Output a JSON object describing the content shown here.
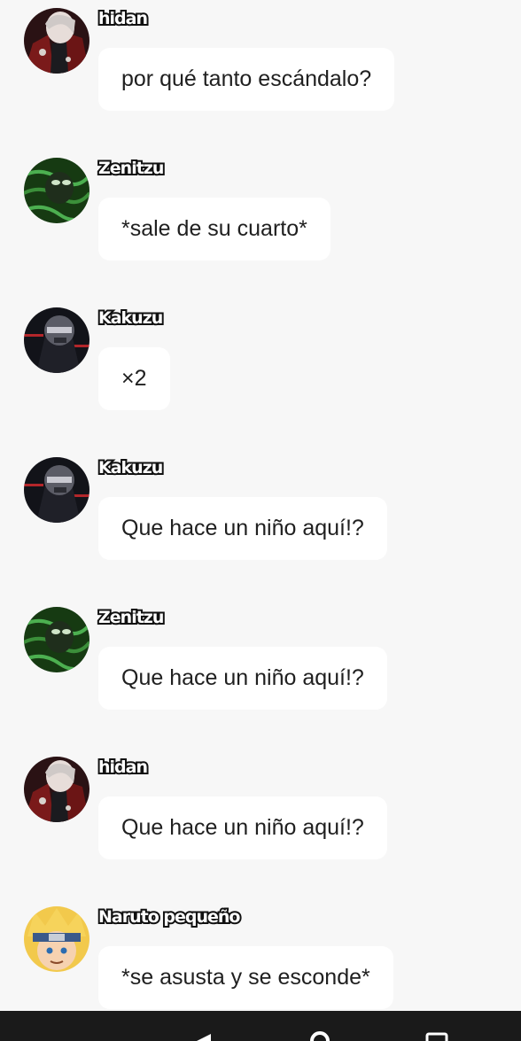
{
  "messages": [
    {
      "author": "hidan",
      "text": "por qué tanto escándalo?",
      "avatar": "hidan-avatar-icon"
    },
    {
      "author": "Zenitzu",
      "text": "*sale de su cuarto*",
      "avatar": "zenitzu-avatar-icon"
    },
    {
      "author": "Kakuzu",
      "text": "×2",
      "avatar": "kakuzu-avatar-icon"
    },
    {
      "author": "Kakuzu",
      "text": "Que hace un niño aquí!?",
      "avatar": "kakuzu-avatar-icon"
    },
    {
      "author": "Zenitzu",
      "text": "Que hace un niño aquí!?",
      "avatar": "zenitzu-avatar-icon"
    },
    {
      "author": "hidan",
      "text": "Que hace un niño aquí!?",
      "avatar": "hidan-avatar-icon"
    },
    {
      "author": "Naruto pequeño",
      "text": "*se asusta y se esconde*",
      "avatar": "naruto-avatar-icon"
    }
  ],
  "navbar": {
    "back": "back-icon",
    "home": "home-icon",
    "recents": "recents-icon"
  },
  "colors": {
    "background": "#f7f7f7",
    "bubble": "#ffffff",
    "text": "#202020",
    "navbar": "#1a1a1a"
  }
}
